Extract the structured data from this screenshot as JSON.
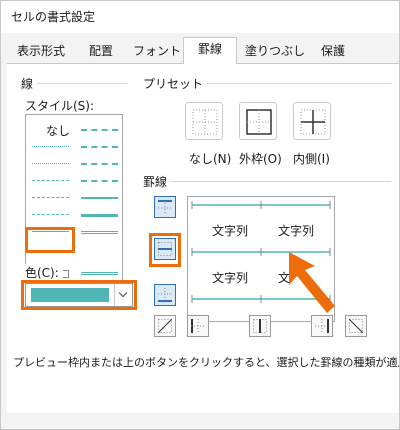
{
  "window": {
    "title": "セルの書式設定"
  },
  "tabs": [
    {
      "label": "表示形式",
      "active": false
    },
    {
      "label": "配置",
      "active": false
    },
    {
      "label": "フォント",
      "active": false
    },
    {
      "label": "罫線",
      "active": true
    },
    {
      "label": "塗りつぶし",
      "active": false
    },
    {
      "label": "保護",
      "active": false
    }
  ],
  "line_section": {
    "group_label": "線",
    "style_label": "スタイル(S):",
    "style_none": "なし",
    "color_label": "色(C):",
    "selected_color": "#4fb5b5",
    "highlight_color": "#ed6c0c"
  },
  "presets": {
    "group_label": "プリセット",
    "items": [
      {
        "label": "なし(N)",
        "icon": "border-none-icon"
      },
      {
        "label": "外枠(O)",
        "icon": "border-outline-icon"
      },
      {
        "label": "内側(I)",
        "icon": "border-inside-icon"
      }
    ]
  },
  "border_section": {
    "group_label": "罫線",
    "preview_text": [
      "文字列",
      "文字列",
      "文字列",
      "文"
    ]
  },
  "hint_text": "プレビュー枠内または上のボタンをクリックすると、選択した罫線の種類が適用されます"
}
